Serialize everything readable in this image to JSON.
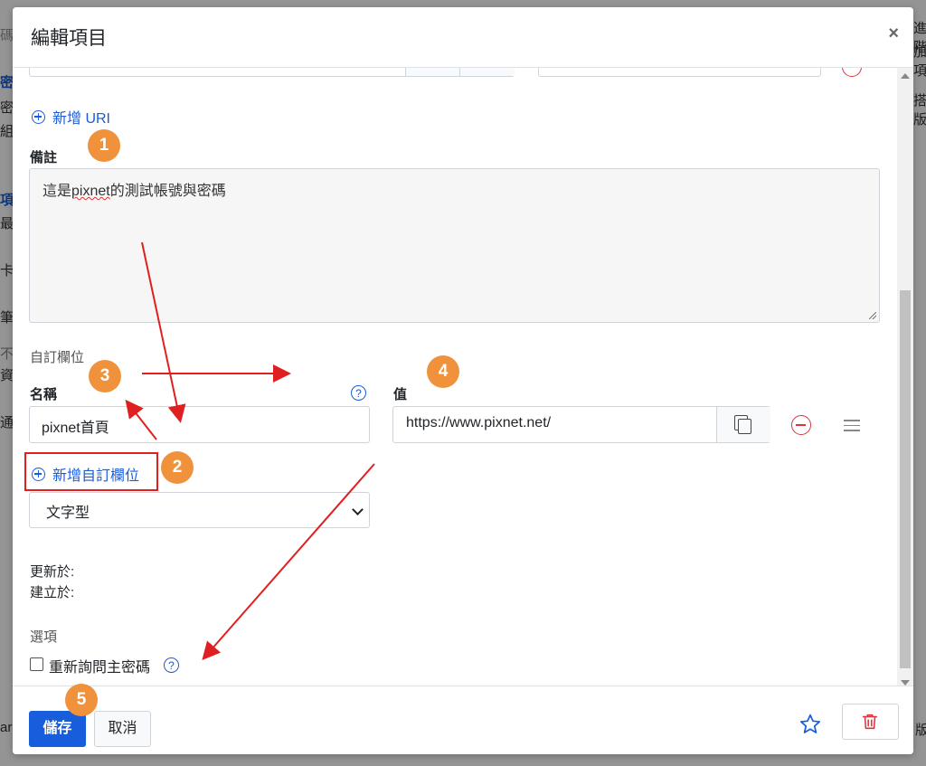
{
  "background": {
    "left_fragments": [
      "碼",
      "密碼",
      "密",
      "組",
      "項目",
      "最",
      "卡",
      "筆",
      "不",
      "資",
      "通",
      "ar"
    ],
    "right_fragments": [
      "進階",
      "加項",
      "搭版",
      "版"
    ]
  },
  "modal": {
    "title": "編輯項目",
    "close_label": "×"
  },
  "uri": {
    "add_uri_label": "新增 URI"
  },
  "notes": {
    "label": "備註",
    "prefix": "這是",
    "misspelled": "pixnet",
    "suffix": "的測試帳號與密碼"
  },
  "custom_fields": {
    "section_label": "自訂欄位",
    "name_header": "名稱",
    "value_header": "值",
    "help_symbol": "?",
    "field_name": "pixnet首頁",
    "field_value": "https://www.pixnet.net/",
    "add_field_label": "新增自訂欄位",
    "field_type_selected": "文字型"
  },
  "meta": {
    "updated_label": "更新於:",
    "created_label": "建立於:"
  },
  "options": {
    "section_label": "選項",
    "reprompt_label": "重新詢問主密碼",
    "reprompt_checked": false
  },
  "footer": {
    "save_label": "儲存",
    "cancel_label": "取消"
  },
  "annotations": {
    "badges": [
      "1",
      "2",
      "3",
      "4",
      "5"
    ],
    "badge_color": "#f0923c",
    "arrow_color": "#e02020"
  },
  "colors": {
    "accent": "#175ddc",
    "danger": "#d9363e"
  }
}
